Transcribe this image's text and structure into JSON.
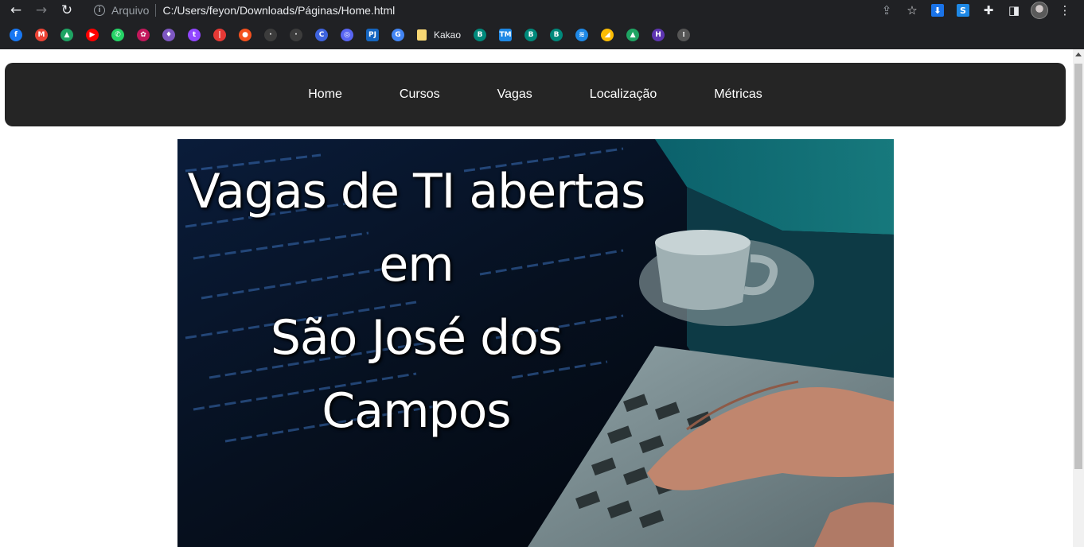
{
  "browser": {
    "back_icon": "←",
    "forward_icon": "→",
    "reload_icon": "↻",
    "info_icon": "i",
    "scheme_label": "Arquivo",
    "url": "C:/Users/feyon/Downloads/Páginas/Home.html",
    "share_icon": "⇪",
    "star_icon": "☆",
    "extensions_icon": "✚",
    "sidepanel_icon": "◨",
    "menu_icon": "⋮",
    "ext_download_icon": "⬇",
    "ext_s_icon": "S"
  },
  "bookmarks": {
    "named_label": "Kakao",
    "icons": [
      {
        "name": "facebook",
        "glyph": "f",
        "color": "#1877f2"
      },
      {
        "name": "gmail",
        "glyph": "M",
        "color": "#ea4335"
      },
      {
        "name": "drive",
        "glyph": "▲",
        "color": "#1fa463"
      },
      {
        "name": "youtube",
        "glyph": "▶",
        "color": "#ff0000"
      },
      {
        "name": "whatsapp",
        "glyph": "✆",
        "color": "#25d366"
      },
      {
        "name": "game",
        "glyph": "✿",
        "color": "#c2185b"
      },
      {
        "name": "crystal",
        "glyph": "♦",
        "color": "#7e57c2"
      },
      {
        "name": "twitch",
        "glyph": "t",
        "color": "#9146ff"
      },
      {
        "name": "red-app",
        "glyph": "|",
        "color": "#e53935"
      },
      {
        "name": "orange-app",
        "glyph": "●",
        "color": "#f4511e"
      },
      {
        "name": "dark-app-1",
        "glyph": "·",
        "color": "#3c3c3c"
      },
      {
        "name": "dark-app-2",
        "glyph": "·",
        "color": "#3c3c3c"
      },
      {
        "name": "canva",
        "glyph": "C",
        "color": "#3e63dd"
      },
      {
        "name": "discord",
        "glyph": "◎",
        "color": "#5865f2"
      },
      {
        "name": "pj-app",
        "glyph": "PJ",
        "color": "#1565c0"
      },
      {
        "name": "translate",
        "glyph": "G",
        "color": "#4285f4"
      }
    ],
    "icons_after": [
      {
        "name": "b-app-1",
        "glyph": "B",
        "color": "#00897b"
      },
      {
        "name": "tm-app",
        "glyph": "TM",
        "color": "#1e88e5"
      },
      {
        "name": "b-app-2",
        "glyph": "B",
        "color": "#00897b"
      },
      {
        "name": "b-app-3",
        "glyph": "B",
        "color": "#00897b"
      },
      {
        "name": "layers-app",
        "glyph": "≋",
        "color": "#1e88e5"
      },
      {
        "name": "ads-app",
        "glyph": "◢",
        "color": "#fbbc04"
      },
      {
        "name": "drive-2",
        "glyph": "▲",
        "color": "#1fa463"
      },
      {
        "name": "h-app",
        "glyph": "H",
        "color": "#5e35b1"
      },
      {
        "name": "cisco",
        "glyph": "⁞",
        "color": "#555555"
      }
    ]
  },
  "site_nav": {
    "items": [
      "Home",
      "Cursos",
      "Vagas",
      "Localização",
      "Métricas"
    ]
  },
  "hero": {
    "lines": [
      "Vagas de TI abertas",
      "em",
      "São José dos",
      "Campos"
    ]
  }
}
